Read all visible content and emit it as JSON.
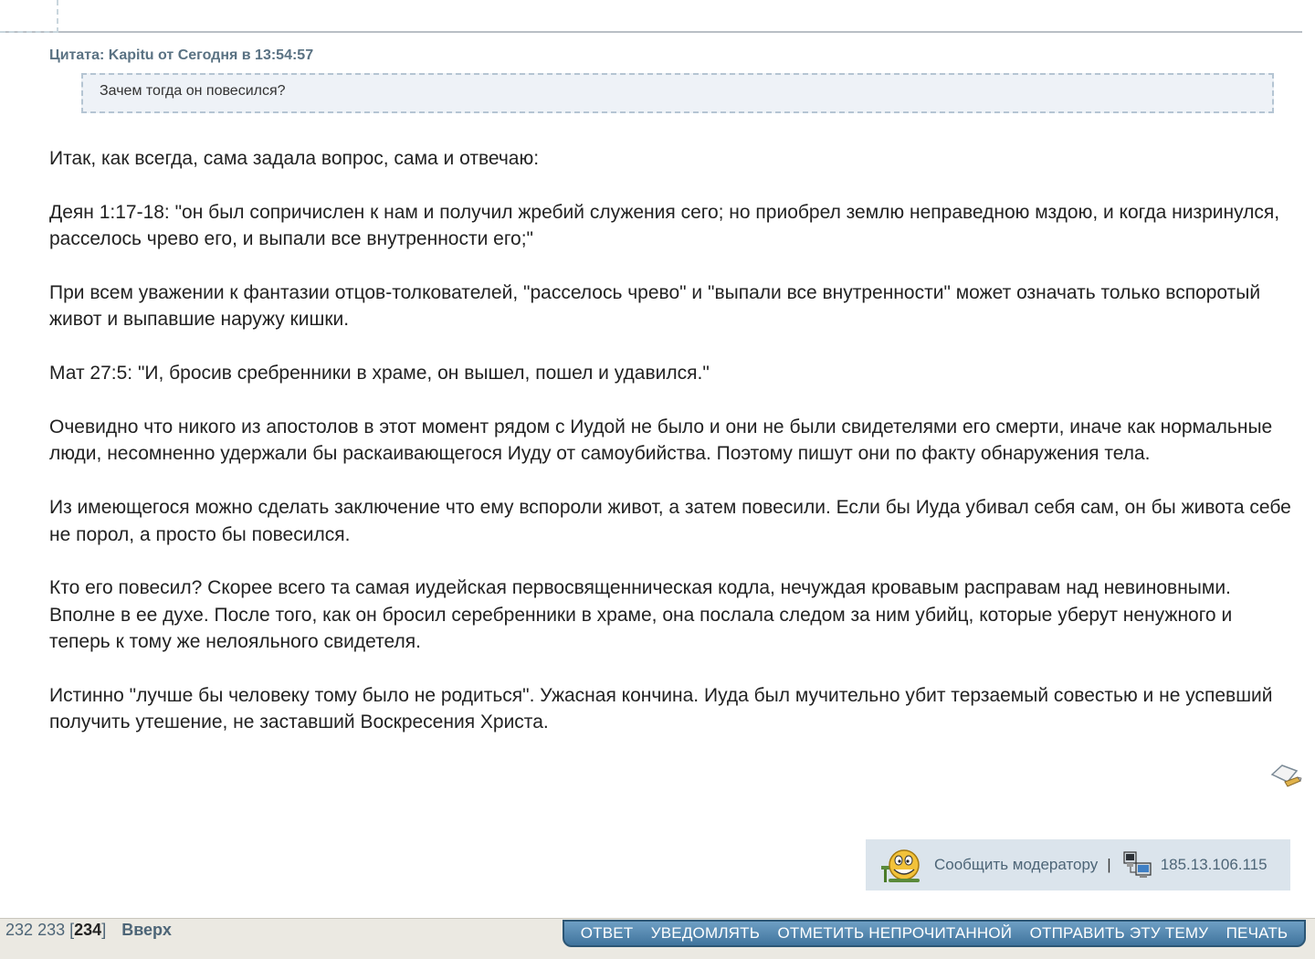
{
  "quote": {
    "label": "Цитата:",
    "author": "Kapitu",
    "from": "от",
    "when": "Сегодня в 13:54:57",
    "text": "Зачем тогда он повесился?"
  },
  "post": {
    "paragraphs": [
      "Итак, как всегда, сама задала вопрос, сама и отвечаю:",
      "Деян 1:17-18: \"он был сопричислен к нам и получил жребий служения сего; но приобрел землю неправедною мздою, и когда низринулся, расселось чрево его, и выпали все внутренности его;\"",
      "При всем уважении к фантазии отцов-толкователей, \"расселось чрево\" и \"выпали все внутренности\" может означать только вспоротый живот и выпавшие наружу кишки.",
      "Мат 27:5: \"И, бросив сребренники в храме, он вышел, пошел и удавился.\"",
      "Очевидно что никого из апостолов в этот момент рядом с Иудой не было и они не были свидетелями его смерти, иначе как нормальные люди, несомненно удержали бы раскаивающегося Иуду от самоубийства. Поэтому пишут они по факту обнаружения тела.",
      "Из имеющегося можно сделать заключение что ему вспороли живот, а затем повесили. Если бы Иуда убивал себя сам, он бы живота себе не порол, а просто бы повесился.",
      "Кто его повесил? Скорее всего та самая иудейская первосвященническая кодла, нечуждая кровавым расправам над невиновными. Вполне в ее духе. После того, как он бросил серебренники в храме, она послала следом за ним убийц, которые уберут ненужного и теперь к тому же нелояльного свидетеля.",
      "Истинно \"лучше бы человеку тому было не родиться\". Ужасная  кончина. Иуда был мучительно убит терзаемый совестью и не успевший получить утешение, не заставший Воскресения Христа."
    ]
  },
  "report": {
    "link_label": "Сообщить модератору",
    "separator": "|",
    "ip": "185.13.106.115"
  },
  "pagination": {
    "pages": [
      "232",
      "233"
    ],
    "current": "234",
    "up_label": "Вверх"
  },
  "actions": [
    "ОТВЕТ",
    "УВЕДОМЛЯТЬ",
    "ОТМЕТИТЬ НЕПРОЧИТАННОЙ",
    "ОТПРАВИТЬ ЭТУ ТЕМУ",
    "ПЕЧАТЬ"
  ],
  "icons": {
    "edit": "modify-post-icon",
    "smiley": "moderator-smiley-icon",
    "ip": "network-computers-icon"
  },
  "colors": {
    "link": "#4d6577",
    "quote_bg": "#eef2f7",
    "action_bar": "#40749d"
  }
}
